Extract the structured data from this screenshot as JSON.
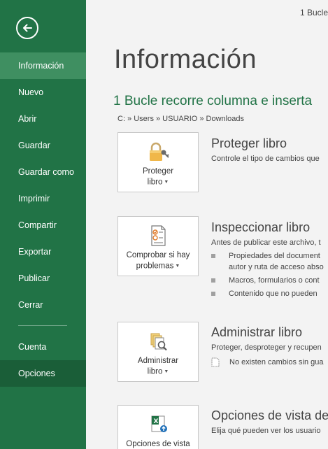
{
  "window": {
    "title": "1 Bucle"
  },
  "sidebar": {
    "back_icon": "arrow-left-icon",
    "items": [
      {
        "label": "Información"
      },
      {
        "label": "Nuevo"
      },
      {
        "label": "Abrir"
      },
      {
        "label": "Guardar"
      },
      {
        "label": "Guardar como"
      },
      {
        "label": "Imprimir"
      },
      {
        "label": "Compartir"
      },
      {
        "label": "Exportar"
      },
      {
        "label": "Publicar"
      },
      {
        "label": "Cerrar"
      },
      {
        "label": "Cuenta"
      },
      {
        "label": "Opciones"
      }
    ],
    "active": "Información",
    "hovered": "Opciones"
  },
  "main": {
    "page_title": "Información",
    "doc_title": "1 Bucle recorre columna e inserta",
    "doc_path": "C: » Users » USUARIO » Downloads",
    "sections": {
      "protect": {
        "card_line1": "Proteger",
        "card_line2": "libro",
        "icon": "lock-key-icon",
        "heading": "Proteger libro",
        "desc": "Controle el tipo de cambios que"
      },
      "inspect": {
        "card_line1": "Comprobar si hay",
        "card_line2": "problemas",
        "icon": "checklist-icon",
        "heading": "Inspeccionar libro",
        "desc": "Antes de publicar este archivo, t",
        "bullets": [
          "Propiedades del document",
          "autor y ruta de acceso abso",
          "Macros, formularios o cont",
          "Contenido que no pueden"
        ]
      },
      "manage": {
        "card_line1": "Administrar",
        "card_line2": "libro",
        "icon": "manage-workbook-icon",
        "heading": "Administrar libro",
        "desc": "Proteger, desproteger y recupen",
        "note": "No existen cambios sin gua"
      },
      "view": {
        "card_line1": "Opciones de vista",
        "icon": "excel-view-options-icon",
        "heading": "Opciones de vista de",
        "desc": "Elija qué pueden ver los usuario"
      }
    }
  },
  "colors": {
    "brand": "#217346",
    "active": "#3f8f61",
    "hover": "#1a5e38"
  }
}
